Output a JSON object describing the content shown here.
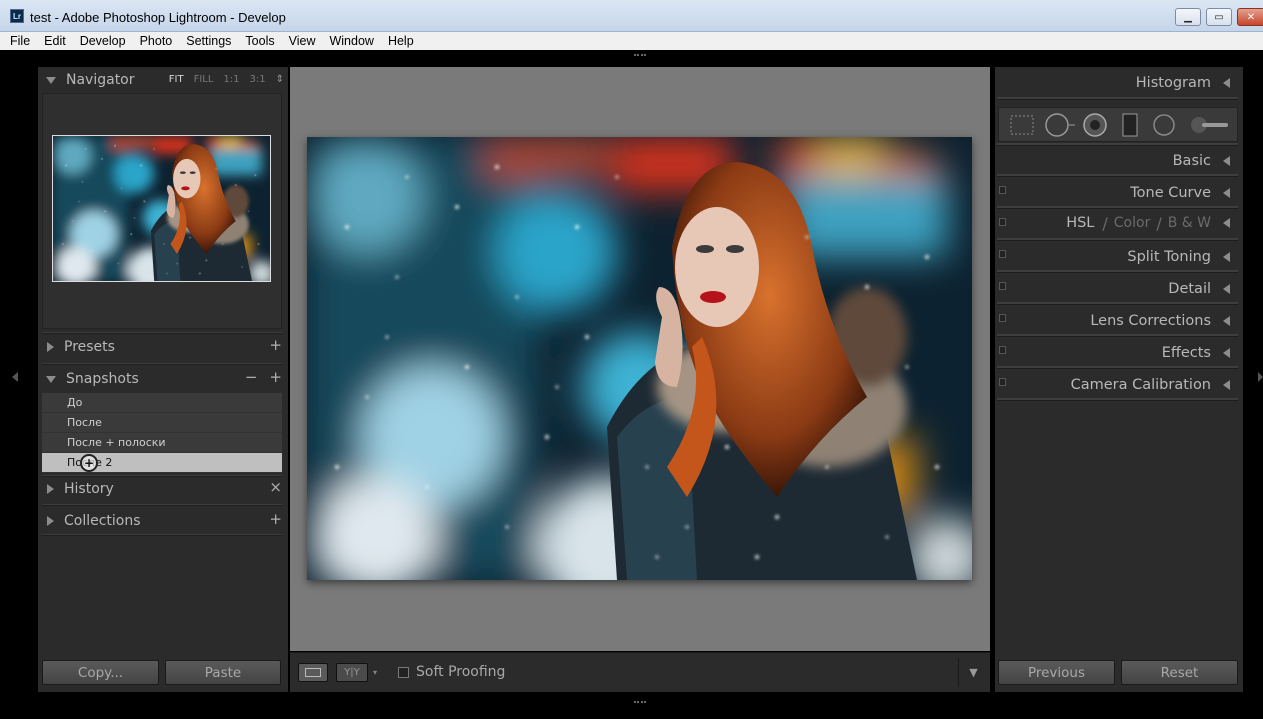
{
  "window": {
    "icon": "Lr",
    "title": "test - Adobe Photoshop Lightroom - Develop",
    "controls": [
      "minimize-icon",
      "maximize-icon",
      "close-icon"
    ]
  },
  "menu": [
    "File",
    "Edit",
    "Develop",
    "Photo",
    "Settings",
    "Tools",
    "View",
    "Window",
    "Help"
  ],
  "left": {
    "navigator": {
      "title": "Navigator",
      "zoom": [
        "FIT",
        "FILL",
        "1:1",
        "3:1"
      ],
      "selected_zoom": "FIT"
    },
    "presets": {
      "title": "Presets",
      "action": "+"
    },
    "snapshots": {
      "title": "Snapshots",
      "actions": [
        "−",
        "+"
      ],
      "items": [
        "До",
        "После",
        "После + полоски",
        "После 2"
      ],
      "selected_index": 3
    },
    "history": {
      "title": "History",
      "action": "×"
    },
    "collections": {
      "title": "Collections",
      "action": "+"
    },
    "buttons": {
      "copy": "Copy...",
      "paste": "Paste"
    }
  },
  "center": {
    "soft_proofing_label": "Soft Proofing",
    "soft_proofing_checked": false,
    "compare_label": "Y|Y"
  },
  "right": {
    "panels": [
      {
        "title": "Histogram",
        "switch": false
      },
      {
        "title": "Basic",
        "switch": false
      },
      {
        "title": "Tone Curve",
        "switch": true
      },
      {
        "title": "HSL",
        "switch": true,
        "extra": [
          "/",
          "Color",
          "/",
          "B & W"
        ]
      },
      {
        "title": "Split Toning",
        "switch": true
      },
      {
        "title": "Detail",
        "switch": true
      },
      {
        "title": "Lens Corrections",
        "switch": true
      },
      {
        "title": "Effects",
        "switch": true
      },
      {
        "title": "Camera Calibration",
        "switch": true
      }
    ],
    "tools": [
      "crop-overlay-icon",
      "spot-removal-icon",
      "red-eye-icon",
      "graduated-filter-icon",
      "radial-filter-icon",
      "adjustment-brush-icon"
    ],
    "buttons": {
      "previous": "Previous",
      "reset": "Reset"
    }
  }
}
